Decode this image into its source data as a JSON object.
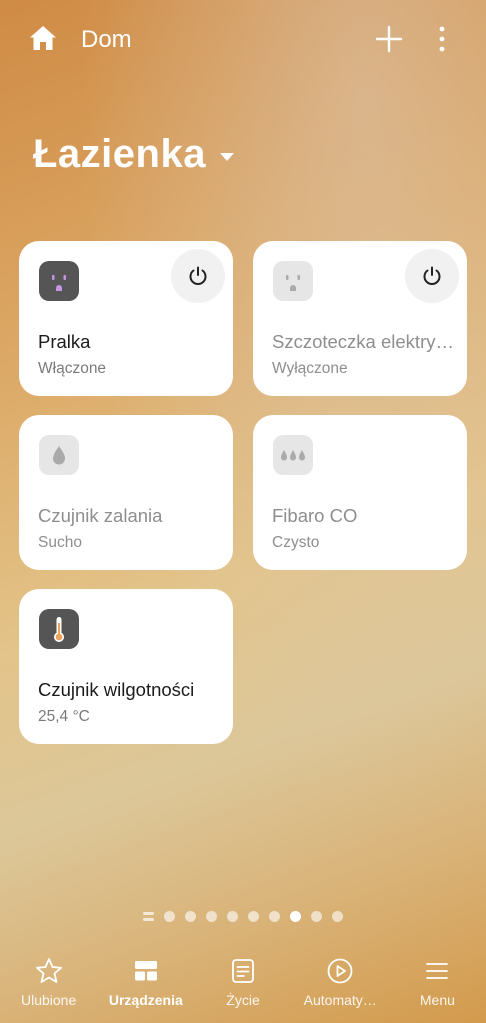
{
  "header": {
    "title": "Dom",
    "icons": [
      "home-icon",
      "plus-icon",
      "more-vertical-icon"
    ]
  },
  "room": {
    "name": "Łazienka"
  },
  "devices": [
    {
      "name": "Pralka",
      "status": "Włączone",
      "state": "on",
      "icon": "outlet-icon",
      "has_power": true
    },
    {
      "name": "Szczoteczka elektryczna",
      "status": "Wyłączone",
      "state": "off",
      "icon": "outlet-icon",
      "has_power": true
    },
    {
      "name": "Czujnik zalania",
      "status": "Sucho",
      "state": "off",
      "icon": "water-drop-icon",
      "has_power": false
    },
    {
      "name": "Fibaro CO",
      "status": "Czysto",
      "state": "off",
      "icon": "drops-icon",
      "has_power": false
    },
    {
      "name": "Czujnik wilgotności",
      "status": "25,4 °C",
      "state": "on",
      "icon": "thermometer-icon",
      "has_power": false
    }
  ],
  "pager": {
    "pages": 9,
    "current": 7
  },
  "nav": [
    {
      "label": "Ulubione",
      "icon": "star-icon",
      "active": false
    },
    {
      "label": "Urządzenia",
      "icon": "devices-icon",
      "active": true
    },
    {
      "label": "Życie",
      "icon": "life-icon",
      "active": false
    },
    {
      "label": "Automaty…",
      "icon": "automation-icon",
      "active": false
    },
    {
      "label": "Menu",
      "icon": "menu-icon",
      "active": false
    }
  ],
  "colors": {
    "icon_on_bg": "#555555",
    "icon_off_bg": "#e6e6e6",
    "outlet_on_accent": "#c895e6",
    "thermo_accent": "#f0a35a"
  }
}
